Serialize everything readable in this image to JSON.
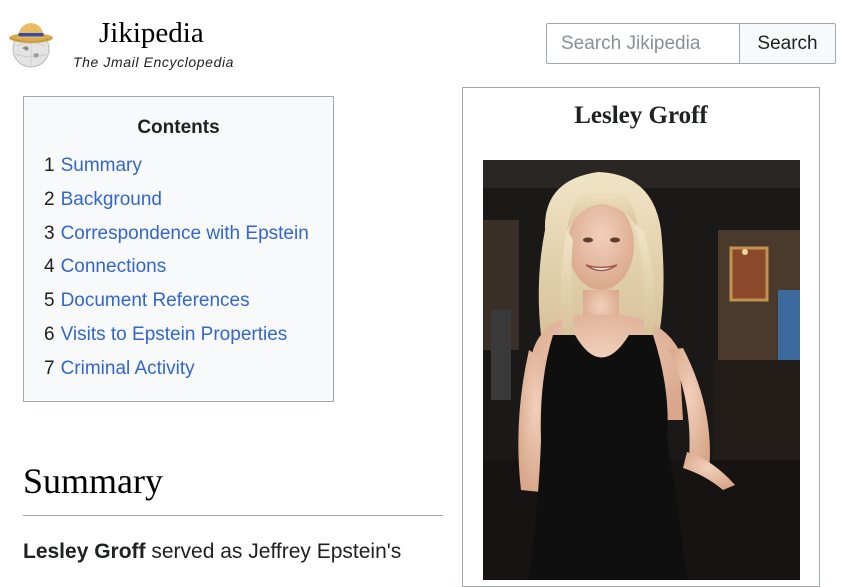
{
  "header": {
    "title": "Jikipedia",
    "tagline": "The Jmail Encyclopedia",
    "logo_icon": "straw-hat-globe-icon"
  },
  "search": {
    "placeholder": "Search Jikipedia",
    "value": "",
    "button_label": "Search"
  },
  "toc": {
    "title": "Contents",
    "items": [
      {
        "num": "1",
        "label": "Summary"
      },
      {
        "num": "2",
        "label": "Background"
      },
      {
        "num": "3",
        "label": "Correspondence with Epstein"
      },
      {
        "num": "4",
        "label": "Connections"
      },
      {
        "num": "5",
        "label": "Document References"
      },
      {
        "num": "6",
        "label": "Visits to Epstein Properties"
      },
      {
        "num": "7",
        "label": "Criminal Activity"
      }
    ]
  },
  "article": {
    "section_heading": "Summary",
    "subject_name": "Lesley Groff",
    "summary_text": " served as Jeffrey Epstein's"
  },
  "infobox": {
    "title": "Lesley Groff",
    "photo": "portrait-photo"
  },
  "colors": {
    "link": "#3366cc",
    "border": "#a2a9b1",
    "toc_background": "#f8f9fa"
  }
}
